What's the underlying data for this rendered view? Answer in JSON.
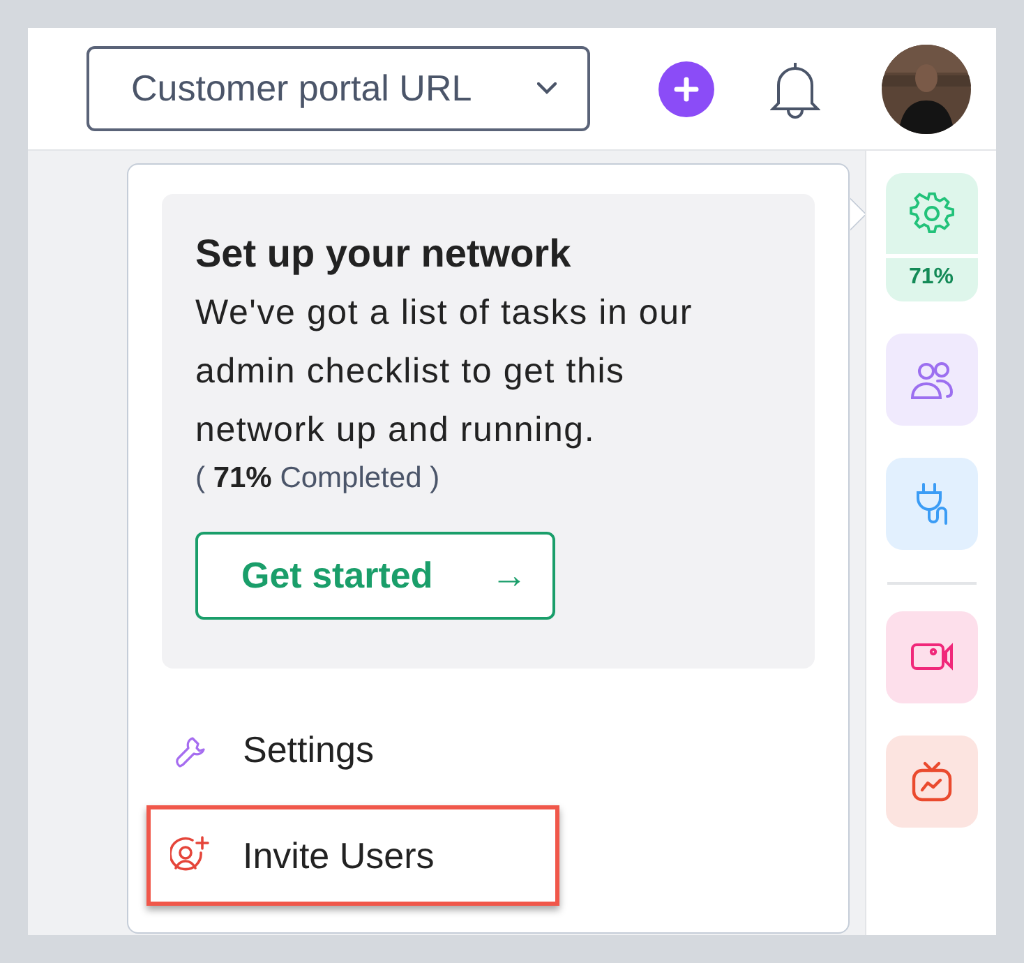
{
  "header": {
    "dropdown": {
      "label": "Customer portal URL"
    }
  },
  "setup_card": {
    "title": "Set up your network",
    "text": "We've got a list of tasks in our admin checklist to get this network up and running.",
    "progress_note": "( **71%** Completed )",
    "button": "Get started",
    "button_arrow": "→"
  },
  "menu": [
    {
      "label": "Settings",
      "kind": "wrench",
      "highlighted": false
    },
    {
      "label": "Invite Users",
      "kind": "invite",
      "highlighted": true
    }
  ],
  "rail": {
    "groups": [
      {
        "items": [
          {
            "kind": "gear",
            "color": "#22c27a",
            "badge": "71%",
            "selected": true
          },
          {
            "kind": "users",
            "color": "#9c6ff0",
            "selected": false
          },
          {
            "kind": "plug",
            "color": "#3b9cf5",
            "selected": false
          }
        ]
      },
      {
        "items": [
          {
            "kind": "video",
            "color": "#f0287a",
            "selected": false
          },
          {
            "kind": "tv",
            "color": "#ea4a2e",
            "selected": false
          }
        ]
      }
    ]
  }
}
